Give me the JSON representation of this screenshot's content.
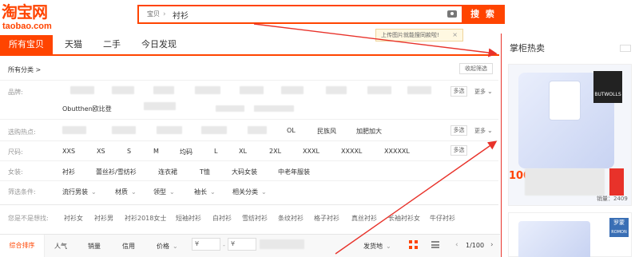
{
  "logo": {
    "cn": "淘宝网",
    "en": "taobao.com"
  },
  "search": {
    "category": "宝贝",
    "query": "衬衫",
    "button": "搜 索"
  },
  "tooltip": {
    "text": "上传图片就能搜同款啦!",
    "close": "×"
  },
  "tabs": [
    {
      "label": "所有宝贝",
      "active": true
    },
    {
      "label": "天猫",
      "active": false
    },
    {
      "label": "二手",
      "active": false
    },
    {
      "label": "今日发现",
      "active": false
    }
  ],
  "filters": {
    "breadcrumb": "所有分类 >",
    "collapse": "收起筛选",
    "multi": "多选",
    "more": "更多",
    "brand_label": "品牌:",
    "brand_visible": "Obutthen欧比登",
    "hot_label": "选购热点:",
    "hot_items": [
      "OL",
      "民族风",
      "加肥加大"
    ],
    "size_label": "尺码:",
    "sizes": [
      "XXS",
      "XS",
      "S",
      "M",
      "均码",
      "L",
      "XL",
      "2XL",
      "XXXL",
      "XXXXL",
      "XXXXXL"
    ],
    "women_label": "女装:",
    "women_items": [
      "衬衫",
      "蕾丝衫/雪纺衫",
      "连衣裙",
      "T恤",
      "大码女装",
      "中老年服装"
    ],
    "cond_label": "筛选条件:",
    "cond_items": [
      "流行男装",
      "材质",
      "领型",
      "袖长",
      "相关分类"
    ],
    "suggest_label": "您是不是想找:",
    "suggest_items": [
      "衬衫女",
      "衬衫男",
      "衬衫2018女士",
      "短袖衬衫",
      "白衬衫",
      "雪纺衬衫",
      "条纹衬衫",
      "格子衬衫",
      "真丝衬衫",
      "长袖衬衫女",
      "牛仔衬衫"
    ]
  },
  "sort": {
    "items": [
      "综合排序",
      "人气",
      "销量",
      "信用",
      "价格"
    ],
    "price_from": "¥",
    "price_sep": "-",
    "price_to": "¥",
    "ship_from": "发货地",
    "page": "1/100"
  },
  "right_panel": {
    "title": "掌柜热卖",
    "product1": {
      "brand": "BUTWOLLS",
      "sold": "销量：2409",
      "price_prefix": "100"
    },
    "product2": {
      "brand_cn": "罗蒙",
      "brand_en": "ROMON"
    }
  },
  "colors": {
    "accent": "#ff4400",
    "arrow": "#e8322a"
  }
}
